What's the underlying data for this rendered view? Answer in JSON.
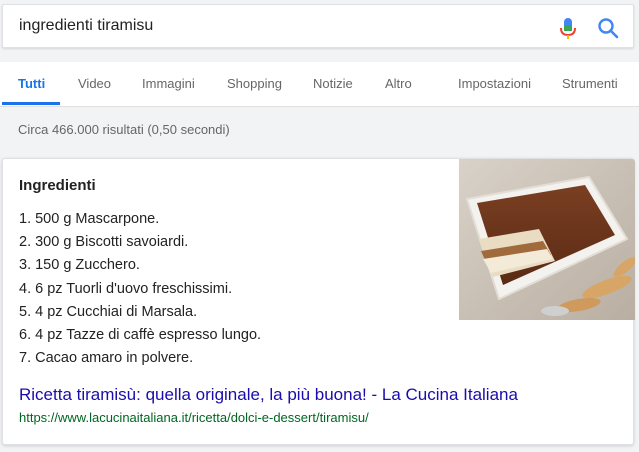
{
  "search": {
    "query": "ingredienti tiramisu"
  },
  "tabs": [
    {
      "label": "Tutti",
      "active": true
    },
    {
      "label": "Video"
    },
    {
      "label": "Immagini"
    },
    {
      "label": "Shopping"
    },
    {
      "label": "Notizie"
    },
    {
      "label": "Altro"
    },
    {
      "label": "Impostazioni"
    },
    {
      "label": "Strumenti"
    }
  ],
  "result_stats": "Circa 466.000 risultati (0,50 secondi)",
  "featured_snippet": {
    "title": "Ingredienti",
    "items": [
      "1. 500 g Mascarpone.",
      "2. 300 g Biscotti savoiardi.",
      "3. 150 g Zucchero.",
      "4. 6 pz Tuorli d'uovo freschissimi.",
      "5. 4 pz Cucchiai di Marsala.",
      "6. 4 pz Tazze di caffè espresso lungo.",
      "7. Cacao amaro in polvere."
    ],
    "link_title": "Ricetta tiramisù: quella originale, la più buona! - La Cucina Italiana",
    "url": "https://www.lacucinaitaliana.it/ricetta/dolci-e-dessert/tiramisu/",
    "image": "tiramisu-dish-photo"
  },
  "colors": {
    "accent": "#1a73e8",
    "link": "#1a0dab",
    "url": "#006621",
    "background": "#f1f3f4"
  },
  "icons": [
    "microphone-icon",
    "search-icon"
  ]
}
